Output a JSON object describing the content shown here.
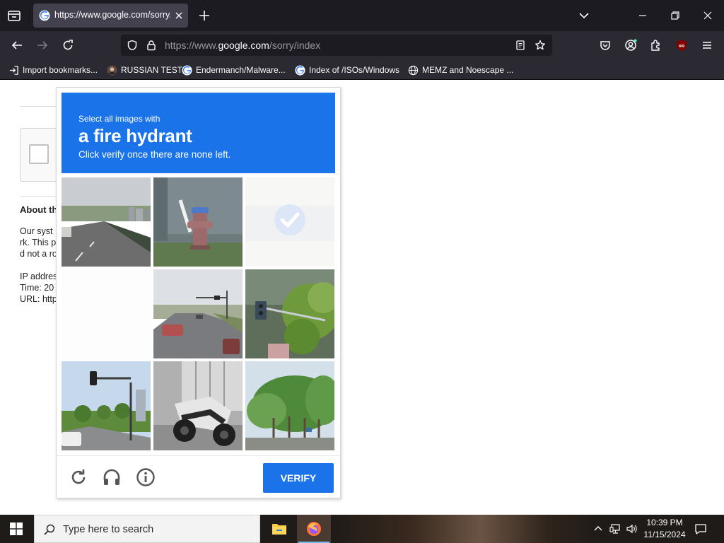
{
  "browser": {
    "tab": {
      "title": "https://www.google.com/sorry/index",
      "favicon": "google-g-icon"
    },
    "url": {
      "prefix": "https://www.",
      "domain": "google.com",
      "path": "/sorry/index"
    },
    "bookmarks": [
      {
        "label": "Import bookmarks...",
        "icon": "import-icon"
      },
      {
        "label": "RUSSIAN TEST",
        "icon": "user-avatar-icon"
      },
      {
        "label": "Endermanch/Malware...",
        "icon": "google-g-icon"
      },
      {
        "label": "Index of /ISOs/Windows",
        "icon": "google-g-icon"
      },
      {
        "label": "MEMZ and Noescape ...",
        "icon": "globe-icon"
      }
    ],
    "colors": {
      "tabbar": "#1c1b22",
      "toolbar": "#2b2a33",
      "tab_active": "#42414d"
    }
  },
  "page": {
    "heading": "About th",
    "lines": [
      "Our syst",
      "rk. This p",
      "d not a ro",
      "IP addres",
      "Time: 20",
      "URL: http"
    ]
  },
  "captcha": {
    "instruction_small": "Select all images with",
    "target": "a fire hydrant",
    "instruction_sub": "Click verify once there are none left.",
    "verify_label": "VERIFY",
    "tiles": [
      {
        "content": "highway road with city buildings",
        "selected": false
      },
      {
        "content": "blue and red fire hydrant",
        "selected": false
      },
      {
        "content": "tile selected, loading",
        "selected": true
      },
      {
        "content": "blank tile, loading",
        "selected": false
      },
      {
        "content": "road with traffic lights and cars",
        "selected": false
      },
      {
        "content": "traffic light with tree",
        "selected": false
      },
      {
        "content": "traffic light over street with palm trees",
        "selected": false
      },
      {
        "content": "parked motorcycle",
        "selected": false
      },
      {
        "content": "road lined with trees",
        "selected": false
      }
    ],
    "colors": {
      "header": "#1a73e8",
      "button": "#1a73e8"
    }
  },
  "taskbar": {
    "search_placeholder": "Type here to search",
    "time": "10:39 PM",
    "date": "11/15/2024"
  }
}
